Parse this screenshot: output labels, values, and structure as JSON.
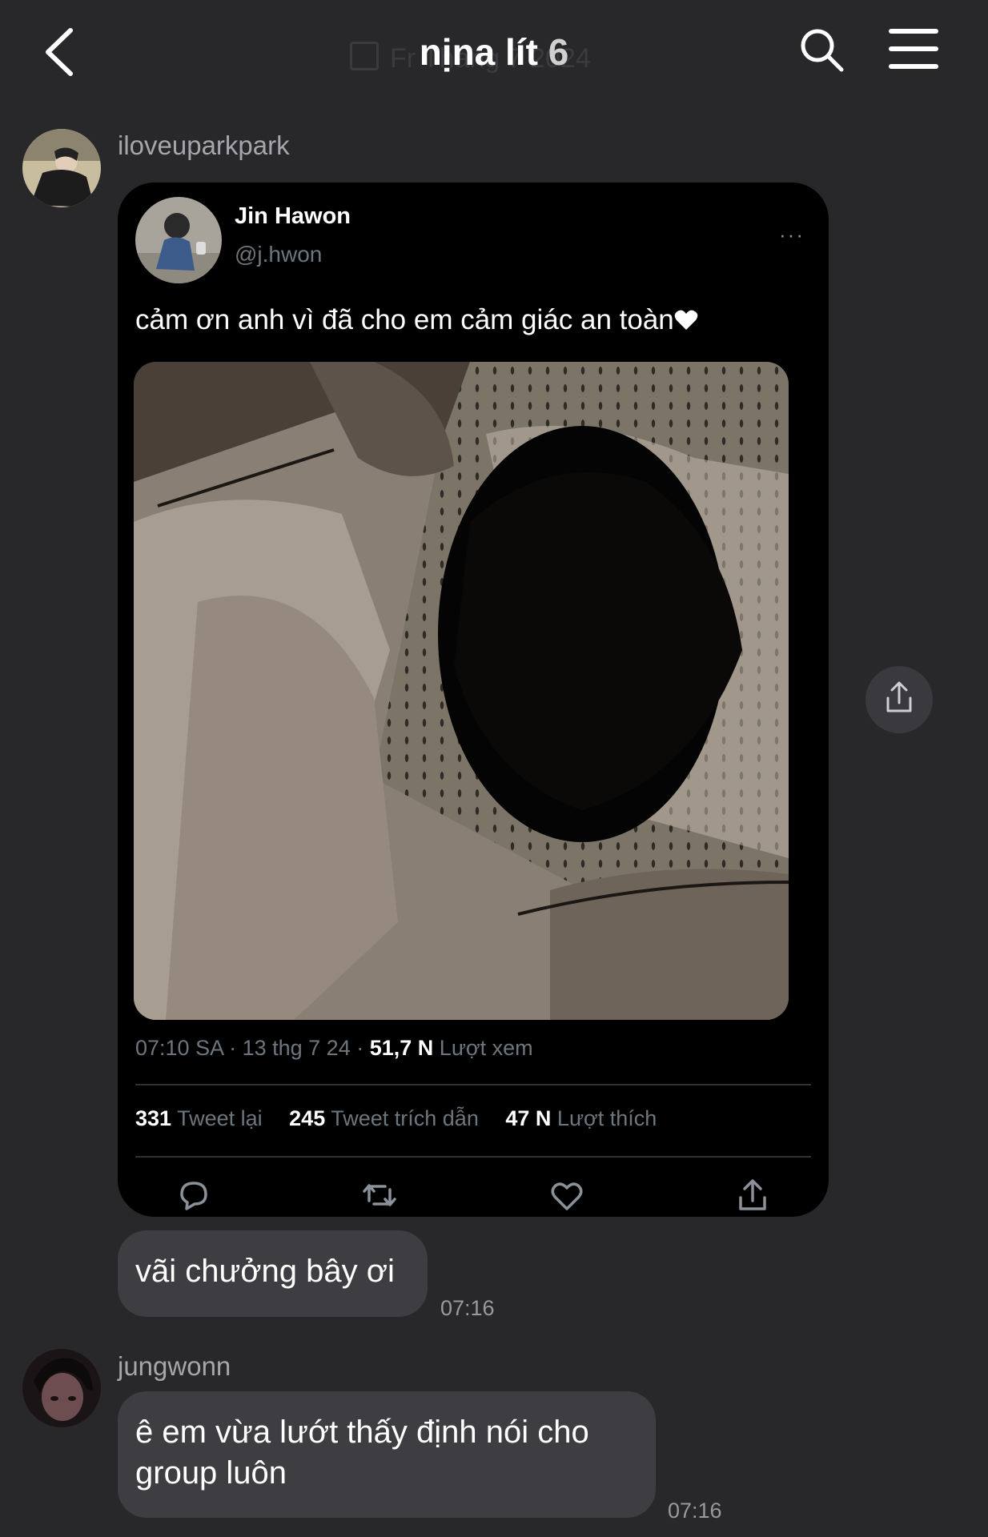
{
  "header": {
    "title": "nịna lít",
    "member_count": "6",
    "date_overlay": "Fr Tháng 7 2024"
  },
  "messages": [
    {
      "sender": "iloveuparkpark",
      "tweet": {
        "author_name": "Jin Hawon",
        "author_handle": "@j.hwon",
        "more": "···",
        "text": "cảm ơn anh vì đã cho em cảm giác an toàn",
        "time_date": "07:10 SA · 13 thg 7 24 ·",
        "views_value": "51,7 N",
        "views_label": "Lượt xem",
        "retweets_value": "331",
        "retweets_label": "Tweet lại",
        "quotes_value": "245",
        "quotes_label": "Tweet trích dẫn",
        "likes_value": "47 N",
        "likes_label": "Lượt thích",
        "action_icons": [
          "reply-icon",
          "retweet-icon",
          "like-icon",
          "share-icon"
        ]
      },
      "text": "vãi chưởng bây ơi",
      "time": "07:16"
    },
    {
      "sender": "jungwonn",
      "text_line1": "ê em vừa lướt thấy định nói cho",
      "text_line2": "group luôn",
      "time": "07:16"
    }
  ],
  "colors": {
    "background": "#28282b",
    "bubble": "#3e3e42",
    "tweet_card": "#000000",
    "muted_text": "#6e767d"
  }
}
